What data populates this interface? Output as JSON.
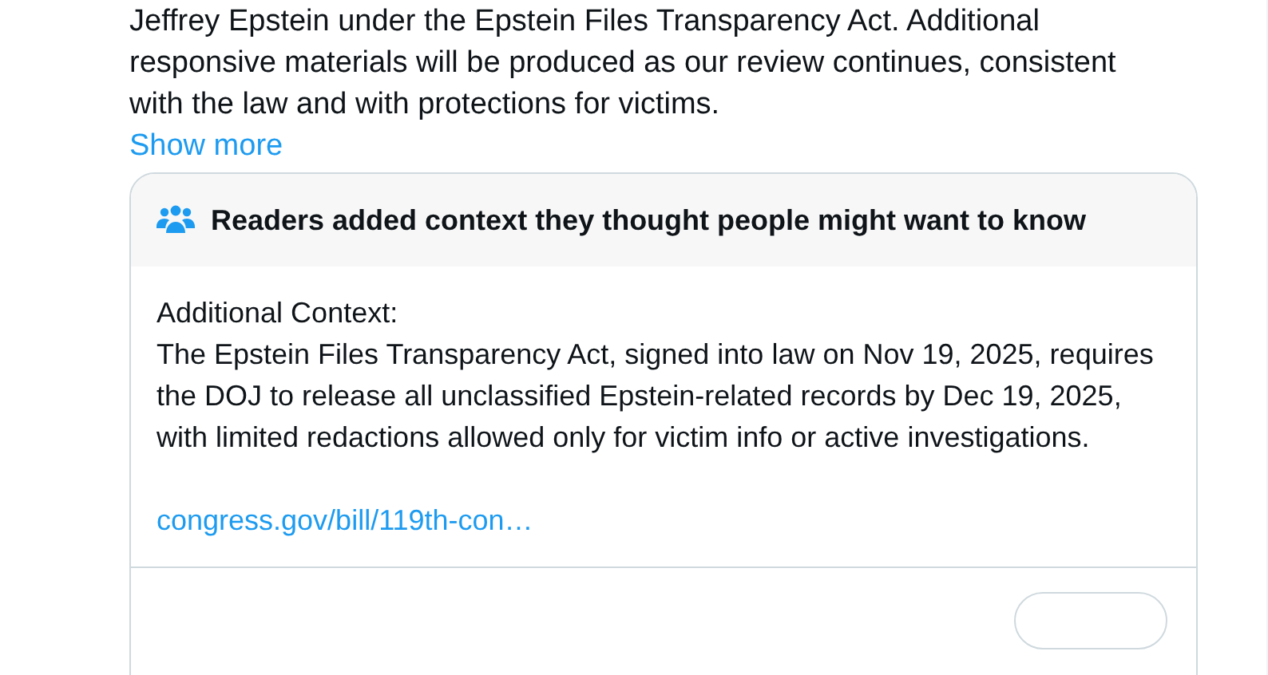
{
  "post": {
    "text_lines": [
      "Jeffrey Epstein under the Epstein Files Transparency Act. Additional",
      "responsive materials will be produced as our review continues, consistent",
      "with the law and with protections for victims."
    ],
    "show_more": "Show more"
  },
  "context_note": {
    "header": "Readers added context they thought people might want to know",
    "label": "Additional Context:",
    "body": "The Epstein Files Transparency Act, signed into law on Nov 19, 2025, requires the DOJ to release all unclassified Epstein-related records by Dec 19, 2025, with limited redactions allowed only for victim info or active investigations.",
    "link": "congress.gov/bill/119th-con…"
  }
}
